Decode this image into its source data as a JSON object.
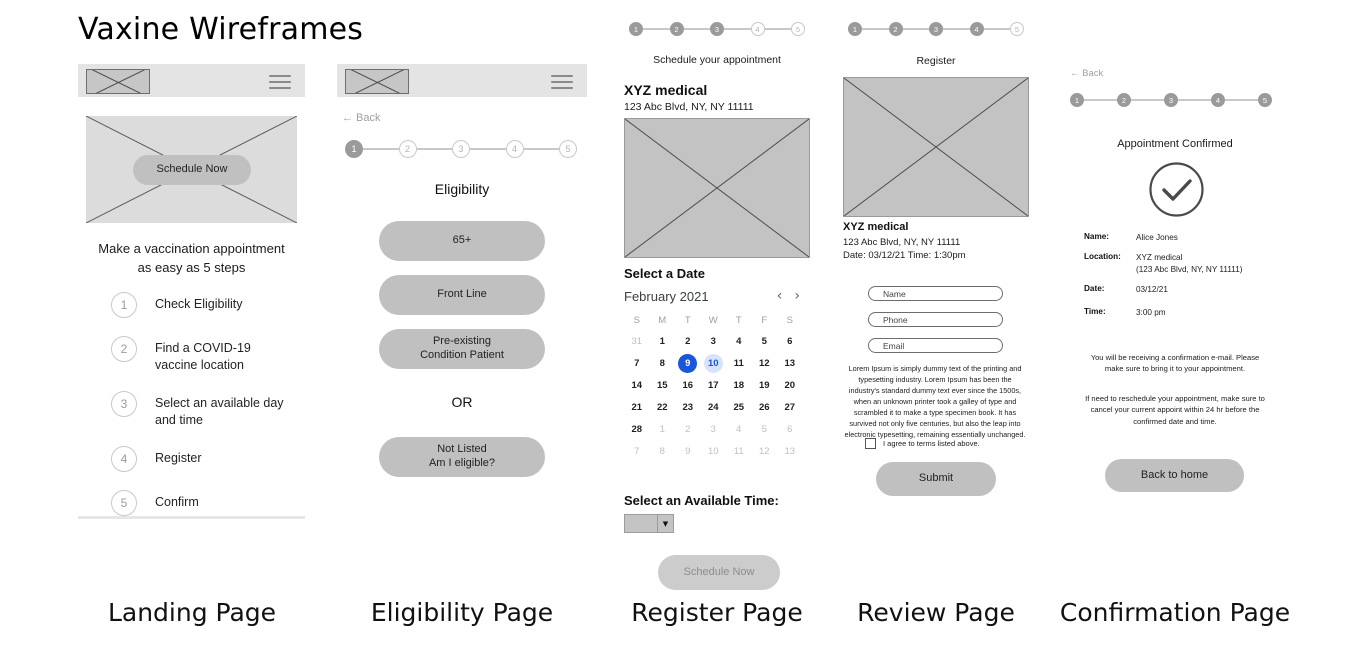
{
  "deck": {
    "title": "Vaxine Wireframes"
  },
  "captions": {
    "landing": "Landing Page",
    "eligibility": "Eligibility Page",
    "register": "Register Page",
    "review": "Review Page",
    "confirmation": "Confirmation Page"
  },
  "colors": {
    "selected_day": "#1a56db",
    "soft_day": "#d7e3fc",
    "appbar": "#e4e4e4",
    "button": "#c0c0c0",
    "placeholder": "#dcdcdc"
  },
  "landing": {
    "hero_button": "Schedule Now",
    "headline_line1": "Make a vaccination appointment",
    "headline_line2": "as easy as 5 steps",
    "steps": [
      {
        "num": "1",
        "label": "Check Eligibility"
      },
      {
        "num": "2",
        "label": "Find a COVID-19\nvaccine location"
      },
      {
        "num": "3",
        "label": "Select an available day\nand time"
      },
      {
        "num": "4",
        "label": "Register"
      },
      {
        "num": "5",
        "label": "Confirm"
      }
    ]
  },
  "eligibility": {
    "back": "← Back",
    "stepper": [
      {
        "num": "1",
        "done": true
      },
      {
        "num": "2",
        "done": false
      },
      {
        "num": "3",
        "done": false
      },
      {
        "num": "4",
        "done": false
      },
      {
        "num": "5",
        "done": false
      }
    ],
    "title": "Eligibility",
    "options": [
      "65+",
      "Front Line",
      "Pre-existing\nCondition Patient"
    ],
    "or_label": "OR",
    "alt_option": "Not Listed\nAm I eligible?"
  },
  "register": {
    "stepper": [
      {
        "num": "1",
        "done": true
      },
      {
        "num": "2",
        "done": true
      },
      {
        "num": "3",
        "done": true
      },
      {
        "num": "4",
        "done": false
      },
      {
        "num": "5",
        "done": false
      }
    ],
    "subtitle": "Schedule your appointment",
    "provider": "XYZ medical",
    "address": "123 Abc Blvd, NY, NY 11111",
    "select_date_label": "Select a Date",
    "calendar": {
      "month": "February 2021",
      "prev_icon": "‹",
      "next_icon": "›",
      "dow": [
        "S",
        "M",
        "T",
        "W",
        "T",
        "F",
        "S"
      ],
      "weeks": [
        [
          {
            "d": "31",
            "state": "muted"
          },
          {
            "d": "1",
            "state": ""
          },
          {
            "d": "2",
            "state": ""
          },
          {
            "d": "3",
            "state": ""
          },
          {
            "d": "4",
            "state": ""
          },
          {
            "d": "5",
            "state": ""
          },
          {
            "d": "6",
            "state": ""
          }
        ],
        [
          {
            "d": "7",
            "state": ""
          },
          {
            "d": "8",
            "state": ""
          },
          {
            "d": "9",
            "state": "sel"
          },
          {
            "d": "10",
            "state": "soft"
          },
          {
            "d": "11",
            "state": ""
          },
          {
            "d": "12",
            "state": ""
          },
          {
            "d": "13",
            "state": ""
          }
        ],
        [
          {
            "d": "14",
            "state": ""
          },
          {
            "d": "15",
            "state": ""
          },
          {
            "d": "16",
            "state": ""
          },
          {
            "d": "17",
            "state": ""
          },
          {
            "d": "18",
            "state": ""
          },
          {
            "d": "19",
            "state": ""
          },
          {
            "d": "20",
            "state": ""
          }
        ],
        [
          {
            "d": "21",
            "state": ""
          },
          {
            "d": "22",
            "state": ""
          },
          {
            "d": "23",
            "state": ""
          },
          {
            "d": "24",
            "state": ""
          },
          {
            "d": "25",
            "state": ""
          },
          {
            "d": "26",
            "state": ""
          },
          {
            "d": "27",
            "state": ""
          }
        ],
        [
          {
            "d": "28",
            "state": ""
          },
          {
            "d": "1",
            "state": "muted"
          },
          {
            "d": "2",
            "state": "muted"
          },
          {
            "d": "3",
            "state": "muted"
          },
          {
            "d": "4",
            "state": "muted"
          },
          {
            "d": "5",
            "state": "muted"
          },
          {
            "d": "6",
            "state": "muted"
          }
        ],
        [
          {
            "d": "7",
            "state": "muted"
          },
          {
            "d": "8",
            "state": "muted"
          },
          {
            "d": "9",
            "state": "muted"
          },
          {
            "d": "10",
            "state": "muted"
          },
          {
            "d": "11",
            "state": "muted"
          },
          {
            "d": "12",
            "state": "muted"
          },
          {
            "d": "13",
            "state": "muted"
          }
        ]
      ]
    },
    "select_time_label": "Select an Available Time:",
    "time_value": "",
    "time_arrow": "▼",
    "submit_button": "Schedule Now"
  },
  "review": {
    "stepper": [
      {
        "num": "1",
        "done": true
      },
      {
        "num": "2",
        "done": true
      },
      {
        "num": "3",
        "done": true
      },
      {
        "num": "4",
        "done": true
      },
      {
        "num": "5",
        "done": false
      }
    ],
    "title": "Register",
    "provider": "XYZ medical",
    "address": "123 Abc Blvd, NY, NY 11111",
    "datetime": "Date: 03/12/21 Time: 1:30pm",
    "fields": [
      {
        "placeholder": "Name",
        "value": ""
      },
      {
        "placeholder": "Phone",
        "value": ""
      },
      {
        "placeholder": "Email",
        "value": ""
      }
    ],
    "terms_paragraph": "Lorem Ipsum is simply dummy text of the printing and typesetting industry. Lorem Ipsum has been the industry's standard dummy text ever since the 1500s, when an unknown printer took a galley of type and scrambled it to make a type specimen book. It has survived not only five centuries, but also the leap into electronic typesetting, remaining essentially unchanged.",
    "agree_label": "I agree to terms listed above.",
    "agree_checked": false,
    "submit_button": "Submit"
  },
  "confirmation": {
    "back": "← Back",
    "stepper": [
      {
        "num": "1",
        "done": true
      },
      {
        "num": "2",
        "done": true
      },
      {
        "num": "3",
        "done": true
      },
      {
        "num": "4",
        "done": true
      },
      {
        "num": "5",
        "done": true
      }
    ],
    "title": "Appointment Confirmed",
    "check_icon": "check-icon",
    "details": [
      {
        "key": "Name:",
        "value": "Alice Jones"
      },
      {
        "key": "Location:",
        "value": "XYZ medical\n(123 Abc Blvd, NY, NY 11111)"
      },
      {
        "key": "Date:",
        "value": "03/12/21"
      },
      {
        "key": "Time:",
        "value": "3:00 pm"
      }
    ],
    "note1": "You will be receiving a confirmation e-mail. Please make sure to bring it to your appointment.",
    "note2": "If need to reschedule your appointment, make sure to cancel your current appoint within 24 hr before the confirmed date and time.",
    "home_button": "Back to home"
  }
}
